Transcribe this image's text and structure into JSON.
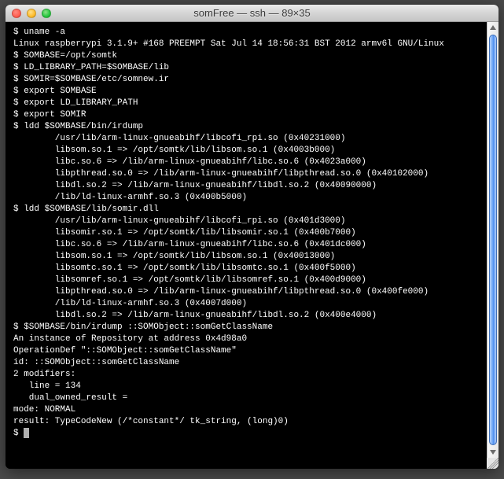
{
  "window": {
    "title": "somFree — ssh — 89×35"
  },
  "prompt": "$ ",
  "lines": [
    "$ uname -a",
    "Linux raspberrypi 3.1.9+ #168 PREEMPT Sat Jul 14 18:56:31 BST 2012 armv6l GNU/Linux",
    "$ SOMBASE=/opt/somtk",
    "$ LD_LIBRARY_PATH=$SOMBASE/lib",
    "$ SOMIR=$SOMBASE/etc/somnew.ir",
    "$ export SOMBASE",
    "$ export LD_LIBRARY_PATH",
    "$ export SOMIR",
    "$ ldd $SOMBASE/bin/irdump",
    "        /usr/lib/arm-linux-gnueabihf/libcofi_rpi.so (0x40231000)",
    "        libsom.so.1 => /opt/somtk/lib/libsom.so.1 (0x4003b000)",
    "        libc.so.6 => /lib/arm-linux-gnueabihf/libc.so.6 (0x4023a000)",
    "        libpthread.so.0 => /lib/arm-linux-gnueabihf/libpthread.so.0 (0x40102000)",
    "        libdl.so.2 => /lib/arm-linux-gnueabihf/libdl.so.2 (0x40090000)",
    "        /lib/ld-linux-armhf.so.3 (0x400b5000)",
    "$ ldd $SOMBASE/lib/somir.dll",
    "        /usr/lib/arm-linux-gnueabihf/libcofi_rpi.so (0x401d3000)",
    "        libsomir.so.1 => /opt/somtk/lib/libsomir.so.1 (0x400b7000)",
    "        libc.so.6 => /lib/arm-linux-gnueabihf/libc.so.6 (0x401dc000)",
    "        libsom.so.1 => /opt/somtk/lib/libsom.so.1 (0x40013000)",
    "        libsomtc.so.1 => /opt/somtk/lib/libsomtc.so.1 (0x400f5000)",
    "        libsomref.so.1 => /opt/somtk/lib/libsomref.so.1 (0x400d9000)",
    "        libpthread.so.0 => /lib/arm-linux-gnueabihf/libpthread.so.0 (0x400fe000)",
    "        /lib/ld-linux-armhf.so.3 (0x4007d000)",
    "        libdl.so.2 => /lib/arm-linux-gnueabihf/libdl.so.2 (0x400e4000)",
    "$ $SOMBASE/bin/irdump ::SOMObject::somGetClassName",
    "An instance of Repository at address 0x4d98a0",
    "OperationDef \"::SOMObject::somGetClassName\"",
    "id: ::SOMObject::somGetClassName",
    "2 modifiers:",
    "   line = 134",
    "   dual_owned_result =",
    "mode: NORMAL",
    "result: TypeCodeNew (/*constant*/ tk_string, (long)0)"
  ]
}
